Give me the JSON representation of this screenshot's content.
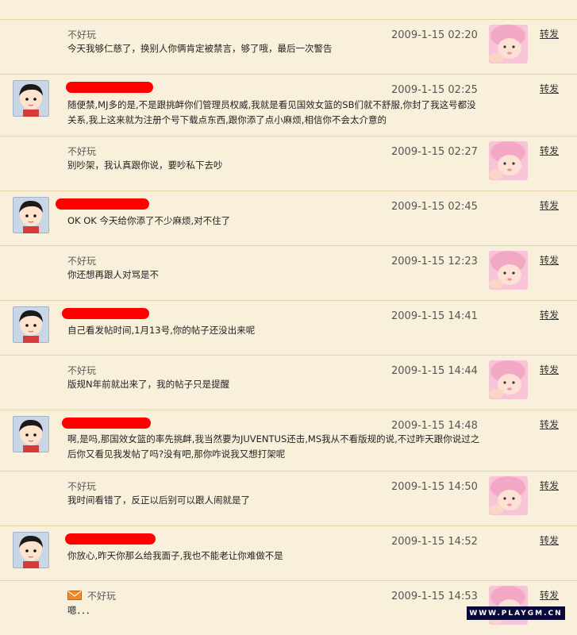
{
  "forward_label": "转发",
  "posts": [
    {
      "author": "不好玩",
      "author_hidden": false,
      "time": "2009-1-15 02:20",
      "text": "今天我够仁慈了，换别人你俩肯定被禁言，够了哦，最后一次警告",
      "avatar_side": "right"
    },
    {
      "author": "",
      "author_hidden": true,
      "time": "2009-1-15 02:25",
      "text": "随便禁,MJ多的是,不是跟挑衅你们管理员权威,我就是看见国效女篮的SB们就不舒服,你封了我这号都没关系,我上这来就为注册个号下载点东西,跟你添了点小麻烦,相信你不会太介意的",
      "avatar_side": "left"
    },
    {
      "author": "不好玩",
      "author_hidden": false,
      "time": "2009-1-15 02:27",
      "text": "别吵架，我认真跟你说，要吵私下去吵",
      "avatar_side": "right"
    },
    {
      "author": "",
      "author_hidden": true,
      "time": "2009-1-15 02:45",
      "text": "OK OK 今天给你添了不少麻烦,对不住了",
      "avatar_side": "left"
    },
    {
      "author": "不好玩",
      "author_hidden": false,
      "time": "2009-1-15 12:23",
      "text": "你还想再跟人对骂是不",
      "avatar_side": "right"
    },
    {
      "author": "",
      "author_hidden": true,
      "time": "2009-1-15 14:41",
      "text": "自己看发帖时间,1月13号,你的帖子还没出来呢",
      "avatar_side": "left"
    },
    {
      "author": "不好玩",
      "author_hidden": false,
      "time": "2009-1-15 14:44",
      "text": "版规N年前就出来了，我的帖子只是提醒",
      "avatar_side": "right"
    },
    {
      "author": "",
      "author_hidden": true,
      "time": "2009-1-15 14:48",
      "text": "啊,是吗,那国效女篮的率先挑衅,我当然要为JUVENTUS还击,MS我从不看版规的说,不过昨天跟你说过之后你又看见我发帖了吗?没有吧,那你咋说我又想打架呢",
      "avatar_side": "left"
    },
    {
      "author": "不好玩",
      "author_hidden": false,
      "time": "2009-1-15 14:50",
      "text": "我时间看错了，反正以后别可以跟人闹就是了",
      "avatar_side": "right"
    },
    {
      "author": "",
      "author_hidden": true,
      "time": "2009-1-15 14:52",
      "text": "你放心,昨天你那么给我面子,我也不能老让你难做不是",
      "avatar_side": "left"
    },
    {
      "author": "不好玩",
      "author_hidden": false,
      "time": "2009-1-15 14:53",
      "text": "嗯．．．",
      "avatar_side": "right",
      "has_envelope": true
    }
  ],
  "watermark": "WWW.PLAYGM.CN"
}
